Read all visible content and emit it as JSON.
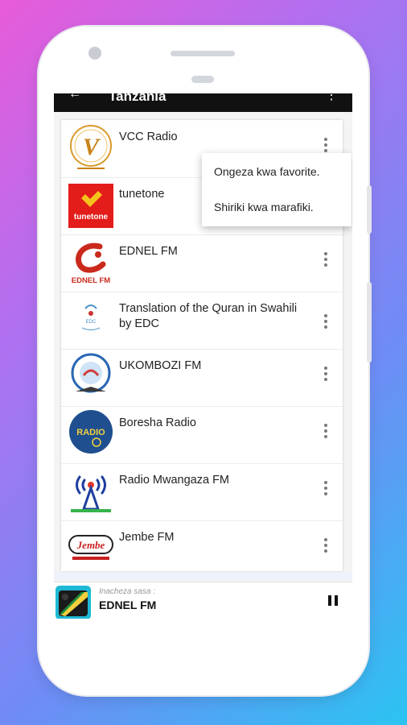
{
  "app": {
    "title": "Tanzania"
  },
  "stations": [
    {
      "name": "VCC Radio",
      "logo_text": "V"
    },
    {
      "name": "tunetone",
      "logo_text": "tunetone"
    },
    {
      "name": "EDNEL FM",
      "logo_text": "EDNEL FM"
    },
    {
      "name": "Translation of the Quran in Swahili by EDC",
      "logo_text": "EDC"
    },
    {
      "name": "UKOMBOZI FM",
      "logo_text": ""
    },
    {
      "name": "Boresha Radio",
      "logo_text": "RADIO"
    },
    {
      "name": "Radio Mwangaza FM",
      "logo_text": ""
    },
    {
      "name": "Jembe FM",
      "logo_text": "Jembe"
    }
  ],
  "popup_menu": {
    "items": [
      "Ongeza kwa favorite.",
      "Shiriki kwa marafiki."
    ]
  },
  "player": {
    "caption": "Inacheza sasa :",
    "station": "EDNEL FM"
  },
  "colors": {
    "background_gradient": [
      "#e85bd9",
      "#2bc4f2"
    ],
    "appbar": "#111111",
    "accent_red": "#e31d1a"
  }
}
